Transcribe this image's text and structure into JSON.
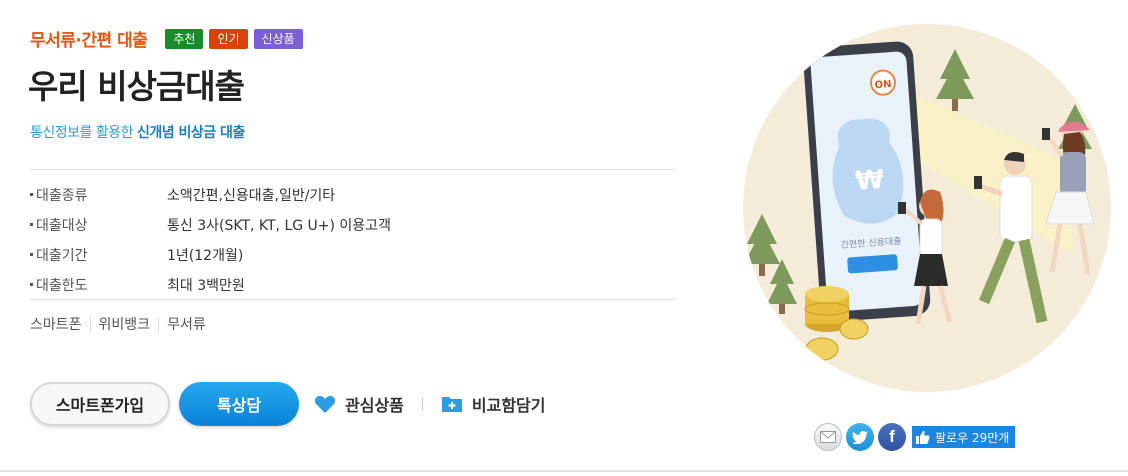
{
  "product": {
    "category": "무서류·간편 대출",
    "badges": [
      "추천",
      "인기",
      "신상품"
    ],
    "title": "우리 비상금대출",
    "subtitle_prefix": "통신정보를 활용한",
    "subtitle_emphasis": "신개념 비상금 대출"
  },
  "specs": [
    {
      "label": "대출종류",
      "value": "소액간편,신용대출,일반/기타"
    },
    {
      "label": "대출대상",
      "value": "통신 3사(SKT, KT, LG U+) 이용고객"
    },
    {
      "label": "대출기간",
      "value": "1년(12개월)"
    },
    {
      "label": "대출한도",
      "value": "최대 3백만원"
    }
  ],
  "tags": [
    "스마트폰",
    "위비뱅크",
    "무서류"
  ],
  "actions": {
    "join_label": "스마트폰가입",
    "talk_label": "톡상담",
    "favorite_label": "관심상품",
    "compare_label": "비교함담기"
  },
  "illustration": {
    "phone_badge": "ON",
    "phone_text": "간편한 신용대출"
  },
  "social": {
    "follow_label": "팔로우 29만개"
  },
  "colors": {
    "accent_orange": "#e8540c",
    "accent_blue": "#2a9fd6",
    "talk_button": "#1a8fe0",
    "badge_recommend": "#1a8a2a",
    "badge_popular": "#d9420b",
    "badge_new": "#7a5fd6"
  }
}
